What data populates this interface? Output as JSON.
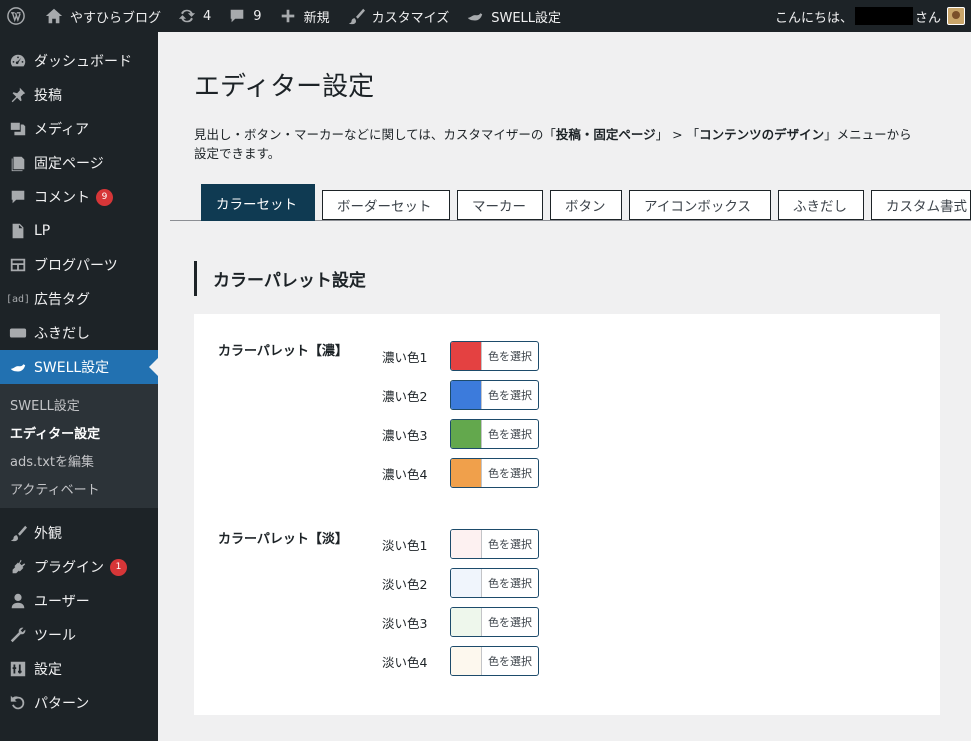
{
  "adminbar": {
    "site_name": "やすひらブログ",
    "updates_count": "4",
    "comments_count": "9",
    "new_label": "新規",
    "customize_label": "カスタマイズ",
    "swell_label": "SWELL設定",
    "greeting": "こんにちは、",
    "greeting_suffix": "さん"
  },
  "sidebar": {
    "items": [
      {
        "label": "ダッシュボード",
        "icon": "dashboard-icon"
      },
      {
        "label": "投稿",
        "icon": "pin-icon"
      },
      {
        "label": "メディア",
        "icon": "media-icon"
      },
      {
        "label": "固定ページ",
        "icon": "page-icon"
      },
      {
        "label": "コメント",
        "icon": "comment-icon",
        "badge": "9"
      },
      {
        "label": "LP",
        "icon": "document-icon"
      },
      {
        "label": "ブログパーツ",
        "icon": "layout-icon"
      },
      {
        "label": "広告タグ",
        "icon": "ad-icon",
        "icon_text": "[ad]"
      },
      {
        "label": "ふきだし",
        "icon": "bubble-icon"
      },
      {
        "label": "SWELL設定",
        "icon": "swell-icon"
      }
    ],
    "submenu": [
      {
        "label": "SWELL設定"
      },
      {
        "label": "エディター設定"
      },
      {
        "label": "ads.txtを編集"
      },
      {
        "label": "アクティベート"
      }
    ],
    "items2": [
      {
        "label": "外観",
        "icon": "brush-icon"
      },
      {
        "label": "プラグイン",
        "icon": "plugin-icon",
        "badge": "1"
      },
      {
        "label": "ユーザー",
        "icon": "user-icon"
      },
      {
        "label": "ツール",
        "icon": "wrench-icon"
      },
      {
        "label": "設定",
        "icon": "settings-icon"
      },
      {
        "label": "パターン",
        "icon": "undo-icon"
      }
    ]
  },
  "main": {
    "title": "エディター設定",
    "description_1": "見出し・ボタン・マーカーなどに関しては、カスタマイザーの「",
    "description_b1": "投稿・固定ページ",
    "description_2": "」 > 「",
    "description_b2": "コンテンツのデザイン",
    "description_3": "」メニューから",
    "description_4": "設定できます。",
    "tabs": [
      {
        "label": "カラーセット"
      },
      {
        "label": "ボーダーセット"
      },
      {
        "label": "マーカー"
      },
      {
        "label": "ボタン"
      },
      {
        "label": "アイコンボックス"
      },
      {
        "label": "ふきだし"
      },
      {
        "label": "カスタム書式"
      }
    ],
    "section_title": "カラーパレット設定",
    "picker_label": "色を選択",
    "groups": [
      {
        "label": "カラーパレット【濃】",
        "colors": [
          {
            "label": "濃い色1",
            "color": "#e44141"
          },
          {
            "label": "濃い色2",
            "color": "#3c7bdc"
          },
          {
            "label": "濃い色3",
            "color": "#63a84d"
          },
          {
            "label": "濃い色4",
            "color": "#f0a04b"
          }
        ]
      },
      {
        "label": "カラーパレット【淡】",
        "colors": [
          {
            "label": "淡い色1",
            "color": "#fdf1f1"
          },
          {
            "label": "淡い色2",
            "color": "#f0f5fc"
          },
          {
            "label": "淡い色3",
            "color": "#eef7ec"
          },
          {
            "label": "淡い色4",
            "color": "#fdf8ee"
          }
        ]
      }
    ]
  }
}
